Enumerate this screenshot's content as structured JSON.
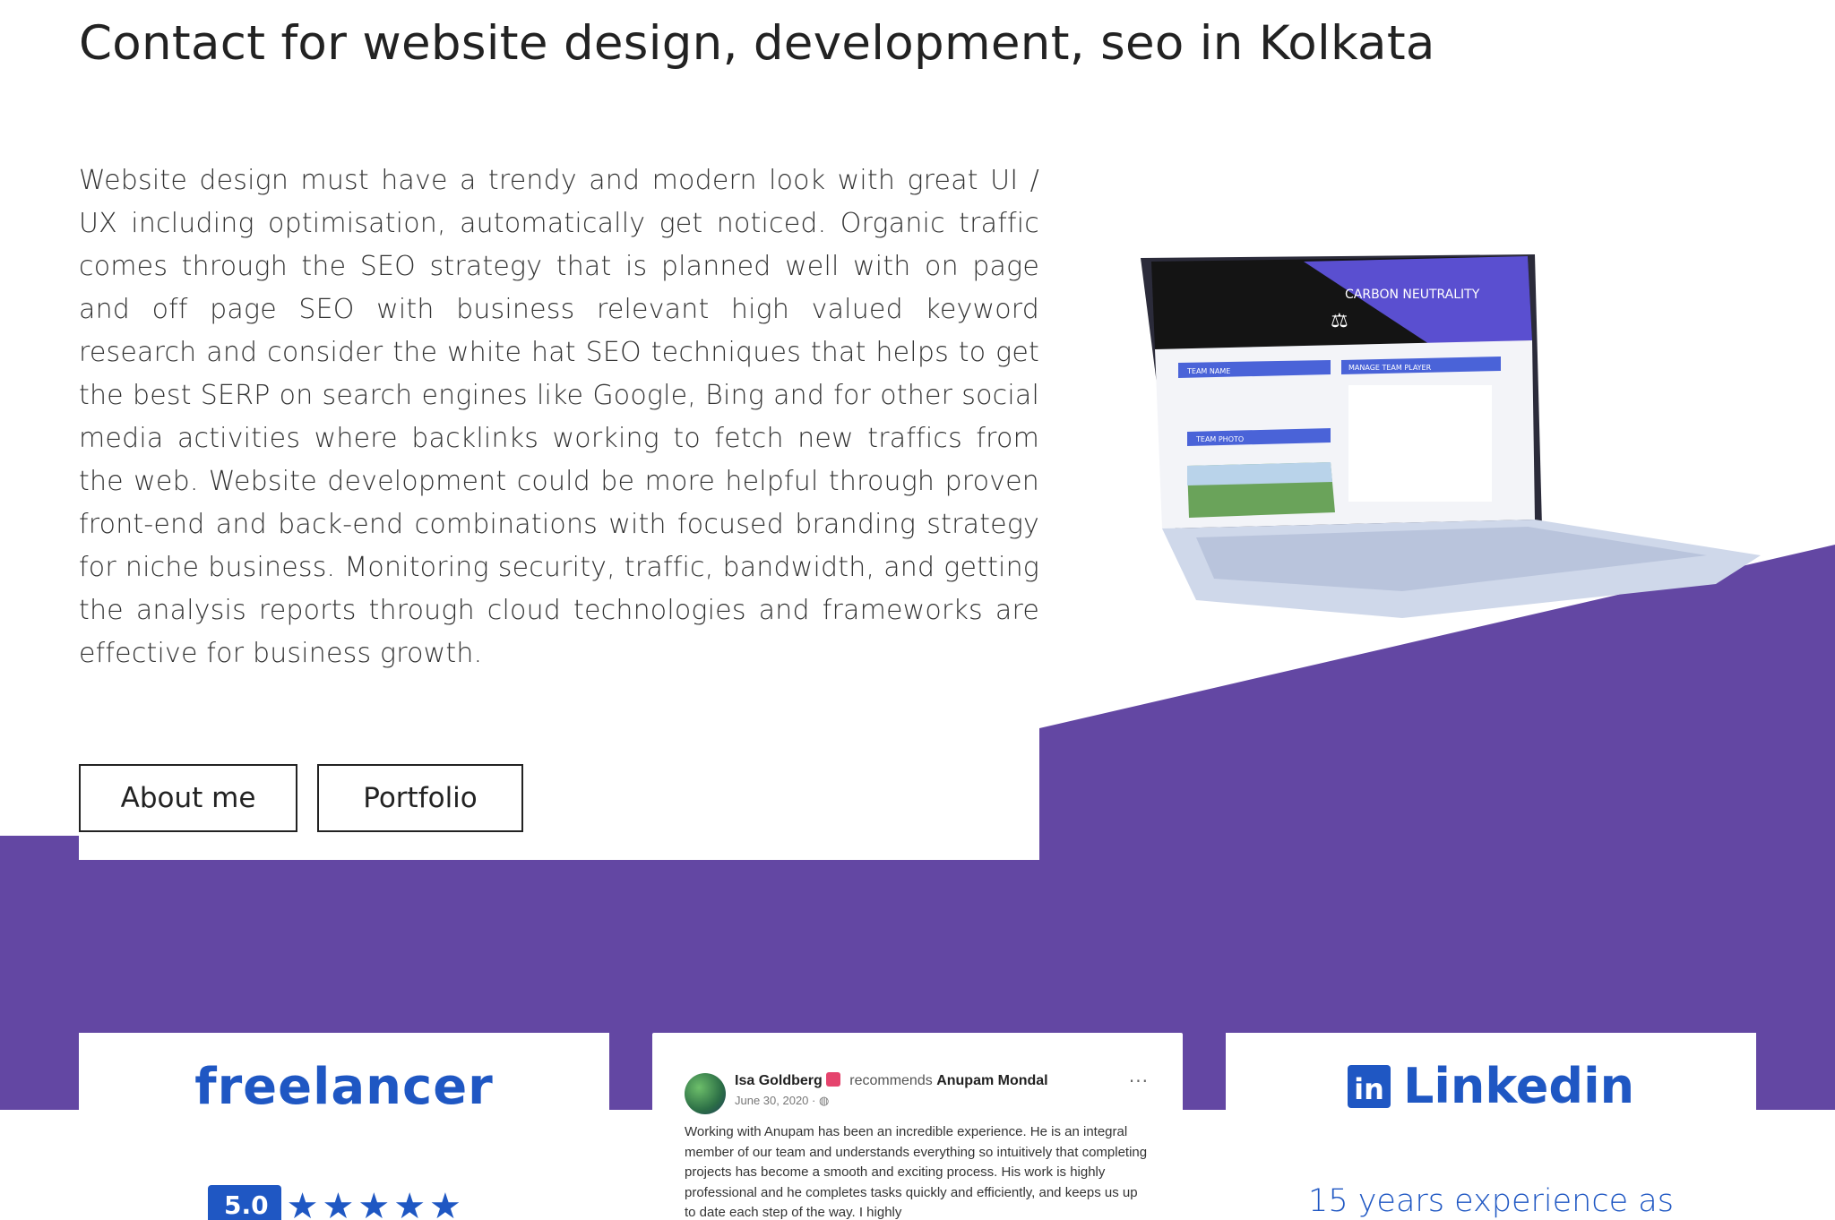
{
  "heading": "Contact for website design, development, seo in Kolkata",
  "intro": "Website design must have a trendy and modern look with great UI / UX including optimisation, automatically get noticed. Organic traffic comes through the SEO strategy that is planned well with on page and off page SEO with business relevant high valued keyword research and consider the white hat SEO techniques that helps to get the best SERP on search engines like Google, Bing and for other social media activities where backlinks working to fetch new traffics from the web. Website development could be more helpful through proven front-end and back-end combinations with focused branding strategy for niche business. Monitoring security, traffic, bandwidth, and getting the analysis reports through cloud technologies and frameworks are effective for business growth.",
  "buttons": {
    "about": "About me",
    "portfolio": "Portfolio"
  },
  "laptop_screen": {
    "banner": "CARBON NEUTRALITY",
    "panel_left_1": "TEAM NAME",
    "panel_left_2": "TEAM PHOTO",
    "panel_right": "MANAGE TEAM PLAYER"
  },
  "freelancer": {
    "brand": "freelancer",
    "rating": "5.0",
    "stars": "★★★★★"
  },
  "review": {
    "author": "Isa Goldberg",
    "action": "recommends",
    "target": "Anupam Mondal",
    "date": "June 30, 2020 · ",
    "more": "···",
    "text": "Working with Anupam has been an incredible experience. He is an integral member of our team and understands everything so intuitively that completing projects has become a smooth and exciting process. His work is highly professional and he completes tasks quickly and efficiently, and keeps us up to date each step of the way. I highly"
  },
  "linkedin": {
    "icon_text": "in",
    "title": "Linkedin",
    "subtitle": "15 years experience as"
  },
  "colors": {
    "purple": "#6347a3",
    "brand_blue": "#1f57c3"
  }
}
